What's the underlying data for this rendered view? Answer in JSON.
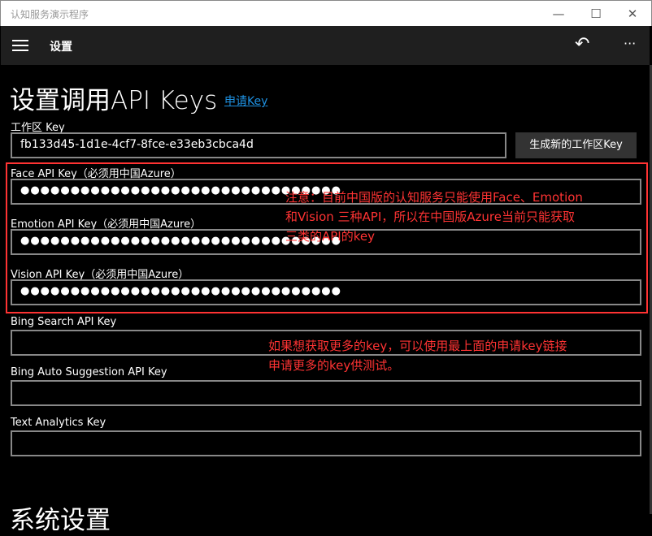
{
  "window": {
    "title": "认知服务演示程序",
    "minimize": "—",
    "maximize": "☐",
    "close": "✕"
  },
  "appbar": {
    "title": "设置",
    "undo_icon": "↶",
    "more_icon": "···"
  },
  "header": {
    "title": "设置调用API Keys",
    "link": "申请Key"
  },
  "workspace": {
    "label": "工作区 Key",
    "value": "fb133d45-1d1e-4cf7-8fce-e33eb3cbca4d",
    "button": "生成新的工作区Key"
  },
  "fields": [
    {
      "label": "Face API Key（必须用中国Azure）",
      "value": "●●●●●●●●●●●●●●●●●●●●●●●●●●●●●●●●"
    },
    {
      "label": "Emotion API Key（必须用中国Azure）",
      "value": "●●●●●●●●●●●●●●●●●●●●●●●●●●●●●●●●"
    },
    {
      "label": "Vision API Key（必须用中国Azure）",
      "value": "●●●●●●●●●●●●●●●●●●●●●●●●●●●●●●●●"
    },
    {
      "label": "Bing Search API Key",
      "value": ""
    },
    {
      "label": "Bing Auto Suggestion API Key",
      "value": ""
    },
    {
      "label": "Text Analytics Key",
      "value": ""
    }
  ],
  "notes": {
    "china": [
      "注意：目前中国版的认知服务只能使用Face、Emotion",
      "和Vision 三种API，所以在中国版Azure当前只能获取",
      "三类的API的key"
    ],
    "more": [
      "如果想获取更多的key，可以使用最上面的申请key链接",
      "申请更多的key供测试。"
    ]
  },
  "section2": {
    "title": "系统设置"
  }
}
